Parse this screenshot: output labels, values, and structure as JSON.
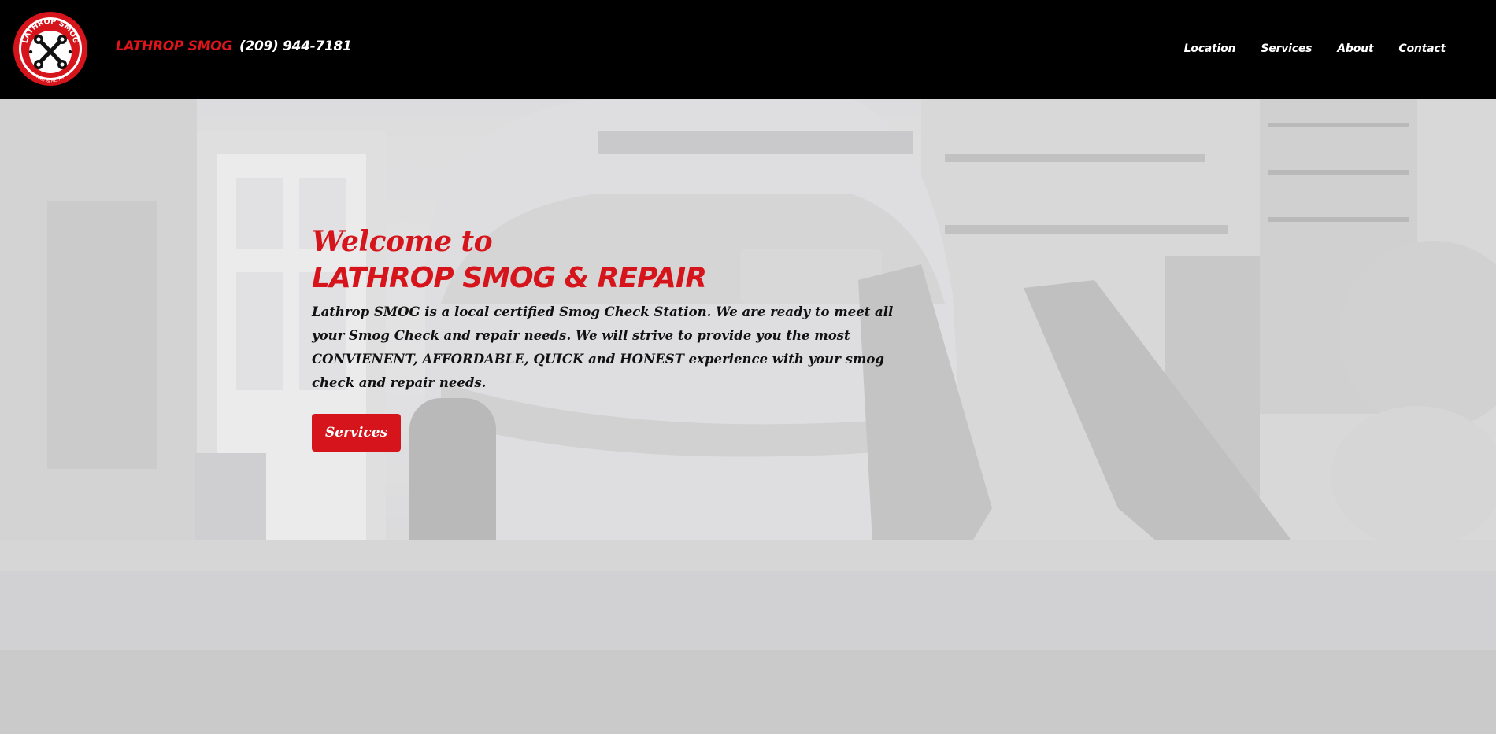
{
  "header": {
    "logo_text_top": "LATHROP SMOG",
    "logo_text_bottom": "TEST & REPAIR",
    "brand_name": "LATHROP SMOG",
    "phone": "(209) 944-7181"
  },
  "nav": {
    "items": [
      {
        "label": "Location"
      },
      {
        "label": "Services"
      },
      {
        "label": "About"
      },
      {
        "label": "Contact"
      }
    ]
  },
  "hero": {
    "welcome": "Welcome to",
    "title": "LATHROP SMOG & REPAIR",
    "description": "Lathrop SMOG is a local certified Smog Check Station. We are ready to meet all your Smog Check and repair needs. We will strive to provide you the most CONVIENENT, AFFORDABLE, QUICK and HONEST experience with your smog check and repair needs.",
    "button_label": "Services"
  },
  "colors": {
    "brand_red": "#d6141b",
    "header_bg": "#000000",
    "nav_text": "#ffffff"
  }
}
